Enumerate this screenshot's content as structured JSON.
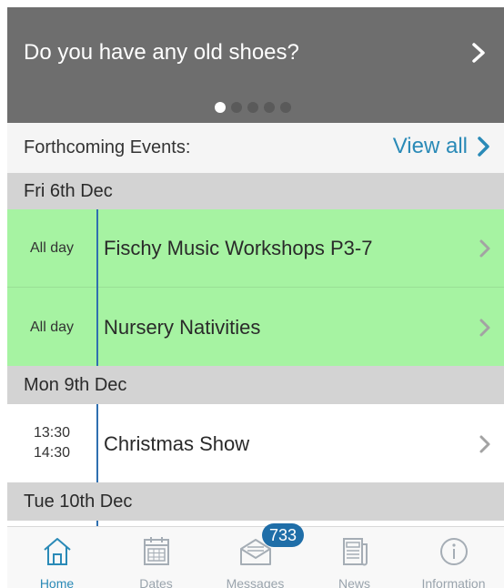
{
  "banner": {
    "title": "Do you have any old shoes?",
    "page_count": 5,
    "active_page": 1
  },
  "forthcoming": {
    "label": "Forthcoming Events:",
    "view_all": "View all"
  },
  "days": [
    {
      "header": "Fri 6th Dec",
      "events": [
        {
          "time": "All day",
          "title": "Fischy Music Workshops P3-7",
          "highlight": true
        },
        {
          "time": "All day",
          "title": "Nursery Nativities",
          "highlight": true
        }
      ]
    },
    {
      "header": "Mon 9th Dec",
      "events": [
        {
          "time_start": "13:30",
          "time_end": "14:30",
          "title": "Christmas Show",
          "highlight": false
        }
      ]
    },
    {
      "header": "Tue 10th Dec",
      "events": []
    }
  ],
  "tabs": [
    {
      "label": "Home",
      "icon": "home-icon",
      "active": true
    },
    {
      "label": "Dates",
      "icon": "calendar-icon",
      "active": false
    },
    {
      "label": "Messages",
      "icon": "envelope-icon",
      "active": false,
      "badge": "733"
    },
    {
      "label": "News",
      "icon": "newspaper-icon",
      "active": false
    },
    {
      "label": "Information",
      "icon": "info-icon",
      "active": false
    }
  ],
  "colors": {
    "accent": "#2a8ab7",
    "highlight_row": "#a6f3a2",
    "banner": "#6e6e6e",
    "day_header": "#d3d3d3",
    "badge": "#1f6ea8"
  }
}
